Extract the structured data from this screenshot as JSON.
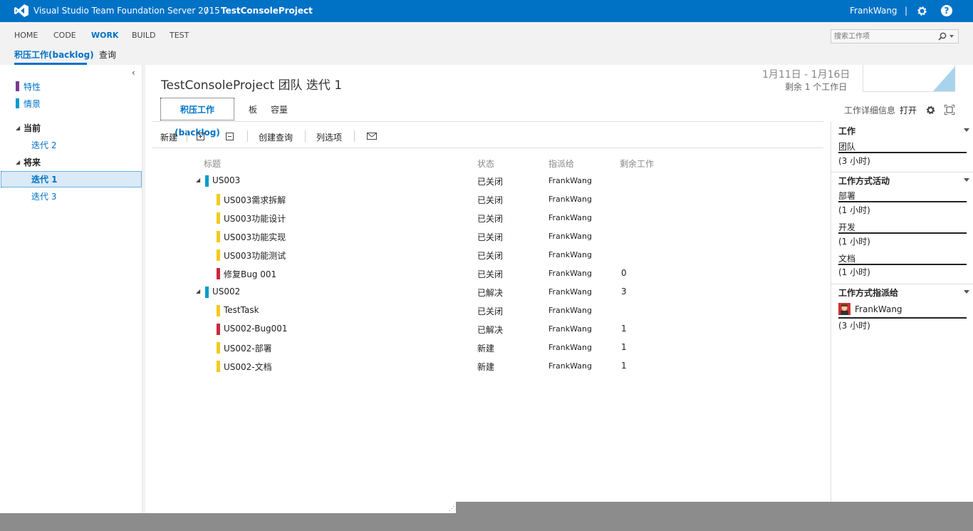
{
  "topbar": {
    "product": "Visual Studio Team Foundation Server 2015",
    "separator": "/",
    "project": "TestConsoleProject",
    "user": "FrankWang",
    "bar": "|",
    "help": "?"
  },
  "hubs": [
    "HOME",
    "CODE",
    "WORK",
    "BUILD",
    "TEST"
  ],
  "search": {
    "placeholder": "搜索工作项"
  },
  "subtabs": [
    "积压工作(backlog)",
    "查询"
  ],
  "leftpanel": {
    "backlogs": [
      {
        "label": "特性",
        "color": "#773b93"
      },
      {
        "label": "情景",
        "color": "#009ccc"
      }
    ],
    "current_label": "当前",
    "current_items": [
      "迭代 2"
    ],
    "future_label": "将来",
    "future_items": [
      "迭代 1",
      "迭代 3"
    ]
  },
  "main": {
    "title": "TestConsoleProject 团队 迭代 1",
    "dates": "1月11日 - 1月16日",
    "remaining": "剩余 1 个工作日",
    "views": [
      "积压工作(backlog)",
      "板",
      "容量"
    ],
    "toolbar": {
      "new": "新建",
      "create_query": "创建查询",
      "column_options": "列选项"
    },
    "columns": {
      "title": "标题",
      "state": "状态",
      "assigned": "指派给",
      "remaining_work": "剩余工作"
    },
    "rows": [
      {
        "title": "US003",
        "state": "已关闭",
        "assigned": "FrankWang",
        "work": "",
        "level": 0,
        "color": "#009ccc"
      },
      {
        "title": "US003需求拆解",
        "state": "已关闭",
        "assigned": "FrankWang",
        "work": "",
        "level": 1,
        "color": "#f2cb1d"
      },
      {
        "title": "US003功能设计",
        "state": "已关闭",
        "assigned": "FrankWang",
        "work": "",
        "level": 1,
        "color": "#f2cb1d"
      },
      {
        "title": "US003功能实现",
        "state": "已关闭",
        "assigned": "FrankWang",
        "work": "",
        "level": 1,
        "color": "#f2cb1d"
      },
      {
        "title": "US003功能测试",
        "state": "已关闭",
        "assigned": "FrankWang",
        "work": "",
        "level": 1,
        "color": "#f2cb1d"
      },
      {
        "title": "修复Bug 001",
        "state": "已关闭",
        "assigned": "FrankWang",
        "work": "0",
        "level": 1,
        "color": "#cc293d"
      },
      {
        "title": "US002",
        "state": "已解决",
        "assigned": "FrankWang",
        "work": "3",
        "level": 0,
        "color": "#009ccc"
      },
      {
        "title": "TestTask",
        "state": "已关闭",
        "assigned": "FrankWang",
        "work": "",
        "level": 1,
        "color": "#f2cb1d"
      },
      {
        "title": "US002-Bug001",
        "state": "已解决",
        "assigned": "FrankWang",
        "work": "1",
        "level": 1,
        "color": "#cc293d"
      },
      {
        "title": "US002-部署",
        "state": "新建",
        "assigned": "FrankWang",
        "work": "1",
        "level": 1,
        "color": "#f2cb1d"
      },
      {
        "title": "US002-文档",
        "state": "新建",
        "assigned": "FrankWang",
        "work": "1",
        "level": 1,
        "color": "#f2cb1d"
      }
    ]
  },
  "rightpanel": {
    "header": "工作详细信息",
    "open": "打开",
    "work_title": "工作",
    "team_label": "团队",
    "team_hours": "(3 小时)",
    "activity_title": "工作方式活动",
    "activities": [
      {
        "label": "部署",
        "hours": "(1 小时)"
      },
      {
        "label": "开发",
        "hours": "(1 小时)"
      },
      {
        "label": "文档",
        "hours": "(1 小时)"
      }
    ],
    "assigned_title": "工作方式指派给",
    "assignee": "FrankWang",
    "assignee_hours": "(3 小时)"
  },
  "colors": {
    "accent": "#0072c6",
    "topbar": "#0072c6"
  }
}
